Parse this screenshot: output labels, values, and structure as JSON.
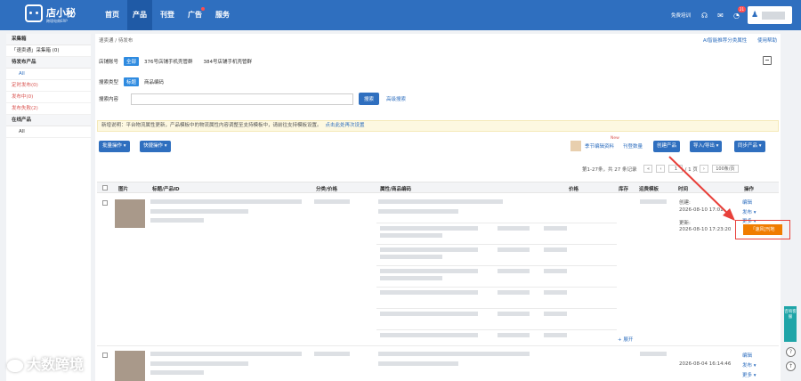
{
  "app": {
    "logo_name": "店小秘",
    "logo_sub": "跨境电商ERP",
    "nav": [
      "首页",
      "产品",
      "刊登",
      "广告",
      "服务"
    ],
    "free_training": "免费培训",
    "badge_count": "21"
  },
  "sidebar": {
    "groups": [
      {
        "title": "采集箱",
        "items": [
          {
            "label": "「速卖通」采集箱 (0)"
          }
        ]
      },
      {
        "title": "待发布产品",
        "items": [
          {
            "label": "All"
          },
          {
            "label": "定时发布(0)"
          },
          {
            "label": "发布中(0)"
          },
          {
            "label": "发布失败(2)"
          }
        ]
      },
      {
        "title": "在线产品",
        "items": [
          {
            "label": "All"
          }
        ]
      }
    ]
  },
  "main": {
    "breadcrumb": "速卖通 / 待发布",
    "top_links": [
      "AI智能推荐分类属性",
      "使用帮助"
    ],
    "store_label": "店铺账号",
    "store_all": "全部",
    "store_1": "376号店铺手机壳管群",
    "store_2": "384号店铺手机壳管群",
    "search_type_label": "搜索类型",
    "search_type_title": "标题",
    "search_type_code": "商品编码",
    "search_content_label": "搜索内容",
    "search_btn": "搜索",
    "advanced_search": "高级搜索",
    "notice_text": "新增说明：平台物流属性更新，产品模板中的物流属性内容调整至支持模板中，请前往支持模板设置。",
    "notice_link": "点击此处再次设置",
    "batch_btn": "批量操作 ▾",
    "quick_btn": "快捷操作 ▾",
    "season_link": "季节编辑资料",
    "new_badge": "New",
    "stock_link": "刊登数量",
    "create_btn": "创建产品",
    "import_btn": "导入/导出 ▾",
    "sync_btn": "同步产品 ▾",
    "pager_text": "第1-27条，共 27 条记录",
    "pager_page": "1",
    "pager_total": "/ 1 页",
    "pager_size": "100条/页"
  },
  "table": {
    "headers": [
      "图片",
      "标题/产品ID",
      "分类/价格",
      "属性/商品编码",
      "价格",
      "库存",
      "运费模板",
      "时间",
      "操作"
    ],
    "row1": {
      "created_label": "创建:",
      "created_time": "2026-08-10 17:01",
      "updated_label": "更新:",
      "updated_time": "2026-08-10 17:23:20",
      "op_edit": "编辑",
      "op_publish": "发布 ▾",
      "op_more": "更多 ▾",
      "op_highlight": "「速风]刊地",
      "expand": "+ 展开"
    },
    "row2": {
      "created_time": "2026-08-04 16:14:46",
      "op_edit": "编辑",
      "op_publish": "发布 ▾",
      "op_more": "更多 ▾"
    }
  },
  "float": {
    "service": "咨询客服",
    "help": "?",
    "up": "↑"
  },
  "watermark": "大数跨境",
  "colors": {
    "topbar": "#2f6fbf",
    "highlight": "#e8403a",
    "orange": "#f07c00"
  }
}
